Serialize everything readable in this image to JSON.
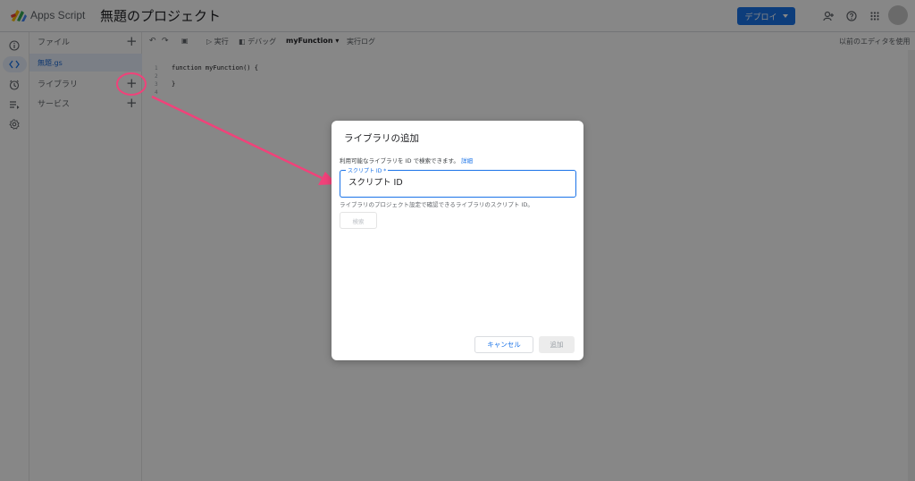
{
  "header": {
    "app_name": "Apps Script",
    "project_title": "無題のプロジェクト",
    "deploy_label": "デプロイ",
    "icons": [
      "add-person-icon",
      "help-icon",
      "apps-grid-icon"
    ]
  },
  "rail": {
    "icons": [
      "overview-icon",
      "editor-icon",
      "triggers-icon",
      "executions-icon",
      "settings-icon"
    ],
    "active": "editor-icon"
  },
  "sidebar": {
    "files_label": "ファイル",
    "file_name": "無題.gs",
    "libraries_label": "ライブラリ",
    "services_label": "サービス"
  },
  "toolbar": {
    "run_label": "実行",
    "debug_label": "デバッグ",
    "function_name": "myFunction",
    "log_label": "実行ログ",
    "legacy_editor_label": "以前のエディタを使用"
  },
  "editor": {
    "line_numbers": [
      "1",
      "2",
      "3",
      "4"
    ],
    "lines": [
      "function myFunction() {",
      "",
      "}",
      ""
    ]
  },
  "dialog": {
    "title": "ライブラリの追加",
    "description": "利用可能なライブラリを ID で検索できます。",
    "details_link": "詳細",
    "field_label": "スクリプト ID *",
    "field_placeholder": "スクリプト ID",
    "field_value": "",
    "help_text": "ライブラリのプロジェクト設定で確認できるライブラリのスクリプト ID。",
    "search_label": "検索",
    "cancel_label": "キャンセル",
    "add_label": "追加"
  },
  "colors": {
    "accent": "#1a73e8",
    "annotation": "#f0427a"
  }
}
